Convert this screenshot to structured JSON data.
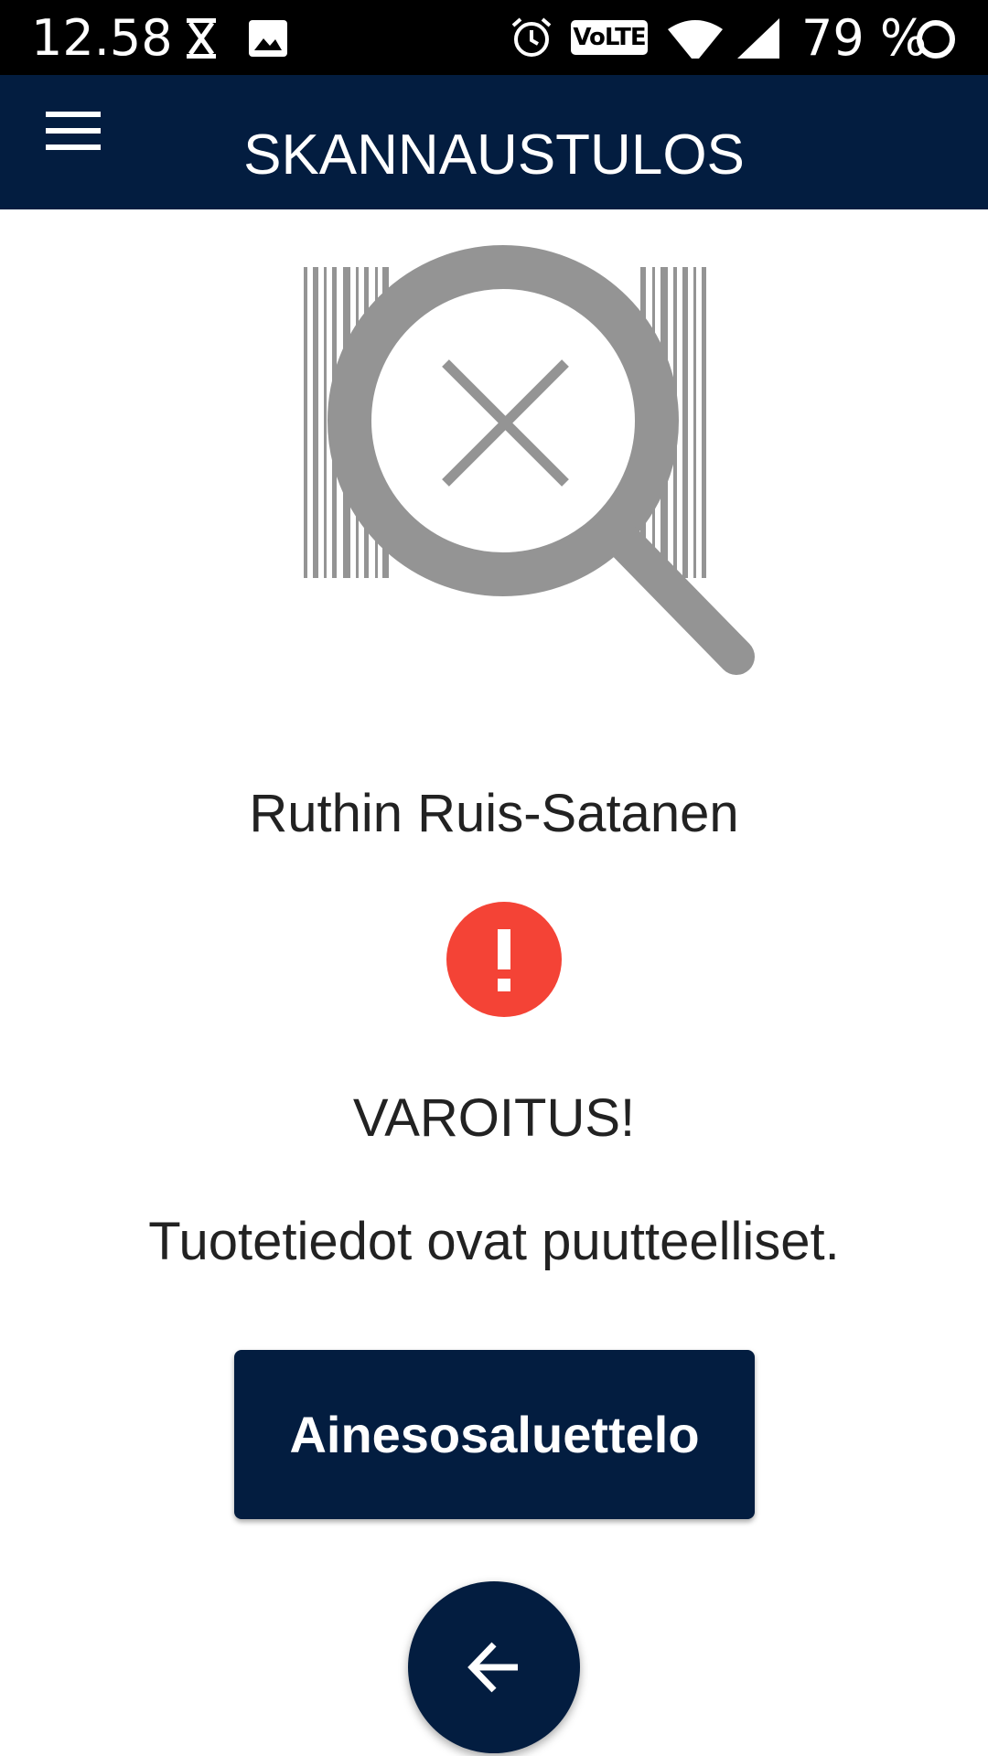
{
  "status_bar": {
    "time": "12.58",
    "battery_percent": "79 %",
    "network_badge": "VoLTE",
    "icons": [
      "hourglass-icon",
      "image-icon",
      "alarm-icon",
      "volte-icon",
      "wifi-icon",
      "signal-icon",
      "battery-ring-icon"
    ]
  },
  "app_bar": {
    "title": "SKANNAUSTULOS",
    "menu_icon": "hamburger-menu-icon"
  },
  "illustration": {
    "icon": "barcode-not-found-magnifier-icon",
    "color": "#949494"
  },
  "product": {
    "name": "Ruthin Ruis-Satanen"
  },
  "warning": {
    "icon": "exclamation-circle-icon",
    "color": "#f44336",
    "title": "VAROITUS!",
    "message": "Tuotetiedot ovat puutteelliset."
  },
  "actions": {
    "ingredients_label": "Ainesosaluettelo",
    "back_icon": "arrow-left-icon"
  },
  "colors": {
    "primary": "#031d40",
    "text": "#222222",
    "background": "#ffffff"
  }
}
